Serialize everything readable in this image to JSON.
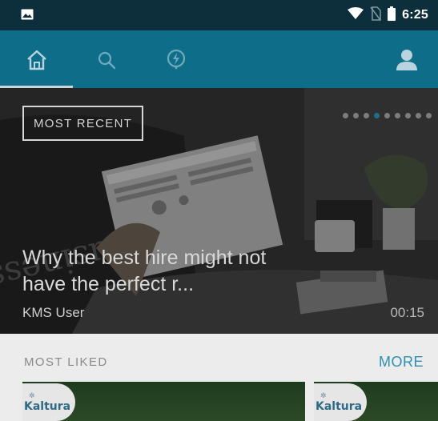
{
  "status_bar": {
    "time": "6:25",
    "icons": [
      "image-icon",
      "wifi-icon",
      "no-sim-icon",
      "battery-icon"
    ]
  },
  "app_bar": {
    "nav": [
      "home-icon",
      "search-icon",
      "bolt-icon",
      "profile-icon"
    ],
    "selected": "home-icon",
    "colors": {
      "background": "#0e6d89",
      "status": "#0d2e3b"
    }
  },
  "hero": {
    "badge": "MOST RECENT",
    "title": "Why the best hire might not have the perfect r...",
    "author": "KMS User",
    "duration": "00:15",
    "newspaper_text": "Business",
    "carousel": {
      "count": 9,
      "active_index": 3
    }
  },
  "most_liked": {
    "title": "MOST LIKED",
    "more_label": "MORE",
    "cards": [
      {
        "logo": "Kaltura"
      },
      {
        "logo": "Kaltura"
      }
    ]
  }
}
